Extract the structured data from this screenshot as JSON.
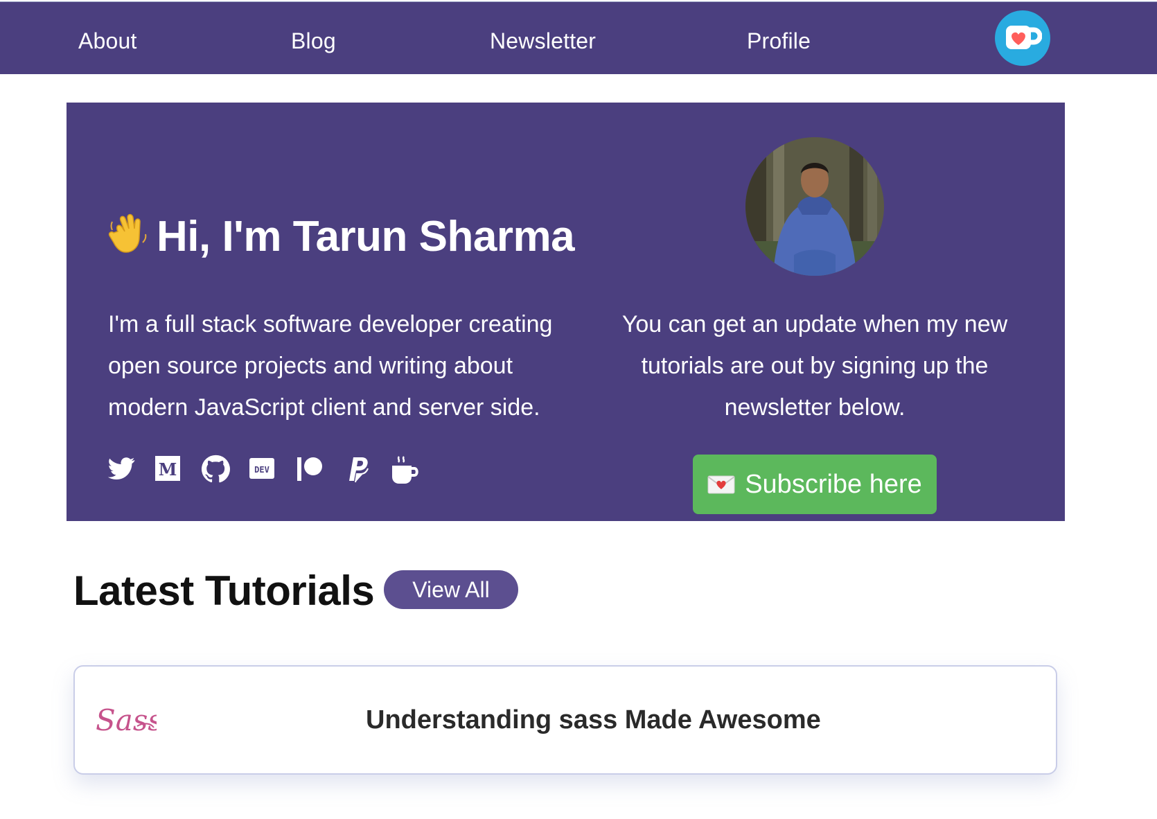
{
  "nav": {
    "links": [
      "About",
      "Blog",
      "Newsletter",
      "Profile"
    ],
    "kofi_icon": "ko-fi-cup-icon"
  },
  "hero": {
    "greeting_emoji": "👋",
    "title": "Hi, I'm Tarun Sharma",
    "intro": "I'm a full stack software developer creating open source projects and writing about modern JavaScript client and server side.",
    "newsletter_text": "You can get an update when my new tutorials are out by signing up the newsletter below.",
    "subscribe_label": "Subscribe here",
    "subscribe_icon": "love-letter-icon",
    "socials": [
      "twitter-icon",
      "medium-icon",
      "github-icon",
      "dev-icon",
      "patreon-icon",
      "paypal-icon",
      "coffee-icon"
    ]
  },
  "tutorials": {
    "heading": "Latest Tutorials",
    "view_all": "View All",
    "items": [
      {
        "logo": "Sass",
        "title": "Understanding sass Made Awesome"
      }
    ]
  },
  "colors": {
    "primary": "#4b3f7f",
    "button_purple": "#5c4f90",
    "subscribe_green": "#5cb85c",
    "kofi_blue": "#29abe0",
    "sass_pink": "#c6538c"
  }
}
